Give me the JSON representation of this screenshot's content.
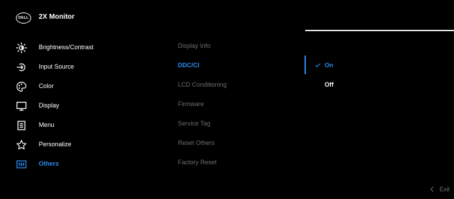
{
  "header": {
    "logo_text": "DELL",
    "title": "2X Monitor"
  },
  "menu": {
    "items": [
      {
        "label": "Brightness/Contrast",
        "icon": "brightness-icon"
      },
      {
        "label": "Input Source",
        "icon": "input-source-icon"
      },
      {
        "label": "Color",
        "icon": "color-palette-icon"
      },
      {
        "label": "Display",
        "icon": "display-monitor-icon"
      },
      {
        "label": "Menu",
        "icon": "menu-list-icon"
      },
      {
        "label": "Personalize",
        "icon": "star-icon"
      },
      {
        "label": "Others",
        "icon": "others-icon",
        "active": true
      }
    ]
  },
  "submenu": {
    "items": [
      {
        "label": "Display Info"
      },
      {
        "label": "DDC/CI",
        "active": true
      },
      {
        "label": "LCD Conditioning"
      },
      {
        "label": "Firmware"
      },
      {
        "label": "Service Tag"
      },
      {
        "label": "Reset Others"
      },
      {
        "label": "Factory Reset"
      }
    ]
  },
  "options": {
    "items": [
      {
        "label": "On",
        "selected": true
      },
      {
        "label": "Off"
      }
    ]
  },
  "footer": {
    "exit_label": "Exit"
  },
  "colors": {
    "accent": "#2b8cf0",
    "background": "#000000",
    "dim_text": "#6d6d6d"
  }
}
